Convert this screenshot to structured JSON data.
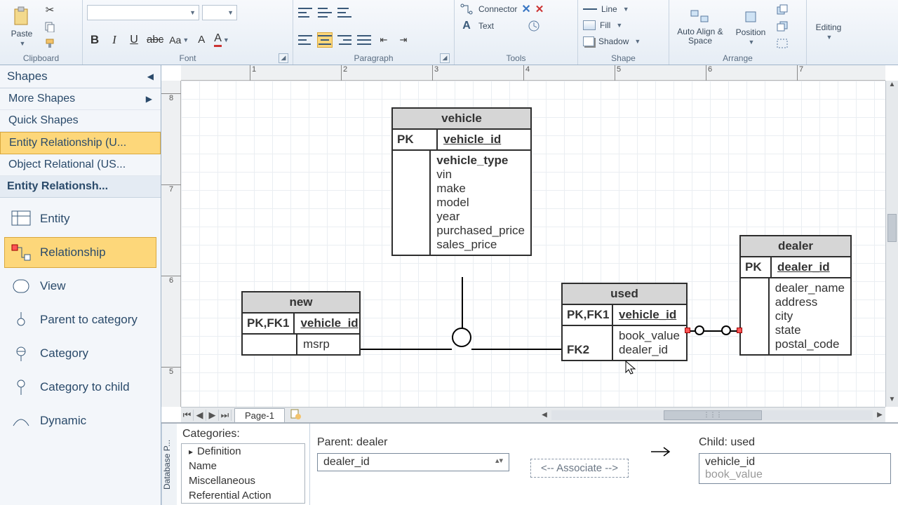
{
  "ribbon": {
    "clipboard": {
      "label": "Clipboard",
      "paste": "Paste"
    },
    "font": {
      "label": "Font"
    },
    "paragraph": {
      "label": "Paragraph"
    },
    "tools": {
      "label": "Tools",
      "connector": "Connector",
      "text": "Text"
    },
    "shape": {
      "label": "Shape",
      "line": "Line",
      "fill": "Fill",
      "shadow": "Shadow"
    },
    "arrange": {
      "label": "Arrange",
      "auto_align": "Auto Align & Space",
      "position": "Position"
    },
    "editing": {
      "label": "Editing"
    }
  },
  "shapes_panel": {
    "title": "Shapes",
    "more": "More Shapes",
    "quick": "Quick Shapes",
    "stencils": [
      "Entity Relationship (U...",
      "Object Relational (US..."
    ],
    "stencil_title": "Entity Relationsh...",
    "items": [
      "Entity",
      "Relationship",
      "View",
      "Parent to category",
      "Category",
      "Category to child",
      "Dynamic"
    ]
  },
  "ruler_h": [
    "1",
    "2",
    "3",
    "4",
    "5",
    "6",
    "7"
  ],
  "ruler_v": [
    "8",
    "7",
    "6",
    "5"
  ],
  "entities": {
    "vehicle": {
      "name": "vehicle",
      "pk_label": "PK",
      "pk": "vehicle_id",
      "attrs": [
        "vehicle_type",
        "vin",
        "make",
        "model",
        "year",
        "purchased_price",
        "sales_price"
      ]
    },
    "new": {
      "name": "new",
      "pk_label": "PK,FK1",
      "pk": "vehicle_id",
      "attrs": [
        "msrp"
      ]
    },
    "used": {
      "name": "used",
      "pk_label": "PK,FK1",
      "pk": "vehicle_id",
      "fk2_label": "FK2",
      "attrs": [
        "book_value",
        "dealer_id"
      ]
    },
    "dealer": {
      "name": "dealer",
      "pk_label": "PK",
      "pk": "dealer_id",
      "attrs": [
        "dealer_name",
        "address",
        "city",
        "state",
        "postal_code"
      ]
    }
  },
  "page_tab": "Page-1",
  "props": {
    "side": "Database P...",
    "cats_title": "Categories:",
    "cats": [
      "Definition",
      "Name",
      "Miscellaneous",
      "Referential Action"
    ],
    "parent_label": "Parent: dealer",
    "child_label": "Child: used",
    "parent_field": "dealer_id",
    "child_fields": [
      "vehicle_id",
      "book_value"
    ],
    "assoc": " <--  Associate  --> "
  }
}
